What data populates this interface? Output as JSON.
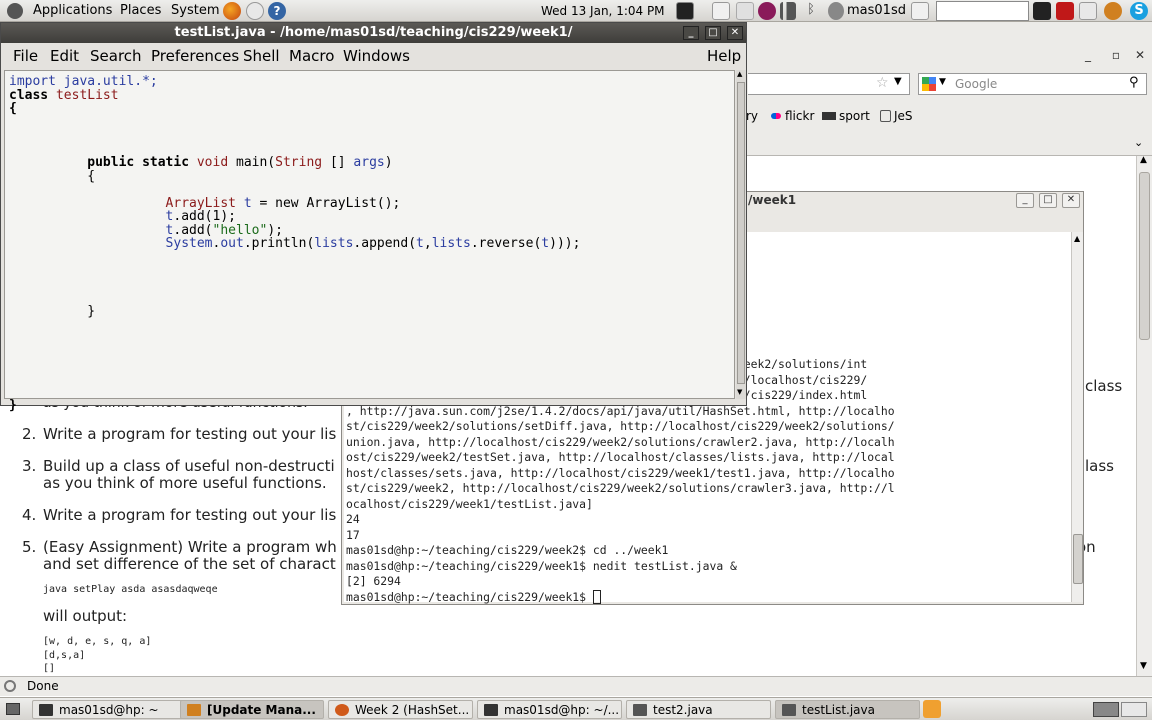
{
  "top_panel": {
    "menus": [
      "Applications",
      "Places",
      "System"
    ],
    "clock": "Wed 13 Jan,  1:04 PM",
    "user": "mas01sd"
  },
  "nedit": {
    "title": "testList.java - /home/mas01sd/teaching/cis229/week1/",
    "menus": [
      "File",
      "Edit",
      "Search",
      "Preferences",
      "Shell",
      "Macro",
      "Windows"
    ],
    "help": "Help",
    "code": {
      "import_kw": "import",
      "import_pkg": "java.util.*;",
      "class_kw": "class",
      "class_name": "testList",
      "open_brace": "{",
      "main_sig_a": "public static",
      "main_sig_void": "void",
      "main_sig_b": "main(",
      "main_sig_string": "String",
      "main_sig_c": "[] ",
      "main_sig_args": "args",
      "main_sig_d": ")",
      "main_open": "{",
      "l1_type": "ArrayList",
      "l1_var": "t",
      "l1_rest": " = new ArrayList();",
      "l2_var": "t",
      "l2_rest": ".add(1);",
      "l3_var": "t",
      "l3_mid": ".add(",
      "l3_str": "\"hello\"",
      "l3_end": ");",
      "l4_sys": "System",
      "l4_dot": ".",
      "l4_out": "out",
      "l4_a": ".println(",
      "l4_lists1": "lists",
      "l4_b": ".append(",
      "l4_t1": "t",
      "l4_c": ",",
      "l4_lists2": "lists",
      "l4_d": ".reverse(",
      "l4_t2": "t",
      "l4_e": ")));",
      "main_close": "}",
      "class_close": "}"
    }
  },
  "terminal": {
    "title": "/week1",
    "lines": [
      "                                                    s229/week2/solutions/int",
      "                                                    http://localhost/cis229/",
      "                                                    alhost/cis229/index.html",
      ", http://java.sun.com/j2se/1.4.2/docs/api/java/util/HashSet.html, http://localho",
      "st/cis229/week2/solutions/setDiff.java, http://localhost/cis229/week2/solutions/",
      "union.java, http://localhost/cis229/week2/solutions/crawler2.java, http://localh",
      "ost/cis229/week2/testSet.java, http://localhost/classes/lists.java, http://local",
      "host/classes/sets.java, http://localhost/cis229/week1/test1.java, http://localho",
      "st/cis229/week2, http://localhost/cis229/week2/solutions/crawler3.java, http://l",
      "ocalhost/cis229/week1/testList.java]",
      "24",
      "17",
      "mas01sd@hp:~/teaching/cis229/week2$ cd ../week1",
      "mas01sd@hp:~/teaching/cis229/week1$ nedit testList.java &",
      "[2] 6294"
    ],
    "prompt": "mas01sd@hp:~/teaching/cis229/week1$ "
  },
  "firefox": {
    "search_placeholder": "Google",
    "bookmarks": [
      "ry",
      "flickr",
      "sport",
      "JeS"
    ],
    "status": "Done",
    "page": {
      "item1_tail": "as you think of more useful functions.",
      "item1_right": "class",
      "item2_num": "2.",
      "item2": "Write a program for testing out your lis",
      "item3_num": "3.",
      "item3_a": "Build up a class of useful non-destructi",
      "item3_b": "as you think of more useful functions.",
      "item3_right": "lass",
      "item4_num": "4.",
      "item4": "Write a program for testing out your lis",
      "item5_num": "5.",
      "item5_a": "(Easy Assignment) Write a program wh",
      "item5_b": "and set difference of the set of charact",
      "item5_right": "on",
      "cmd": "java setPlay asda asasdaqweqe",
      "will_output": "will output:",
      "out1": "[w, d, e, s, q, a]",
      "out2": "[d,s,a]",
      "out3": "[]"
    }
  },
  "taskbar": {
    "tasks": [
      "mas01sd@hp: ~",
      "[Update Mana...",
      "Week 2 (HashSet...",
      "mas01sd@hp: ~/...",
      "test2.java",
      "testList.java"
    ]
  }
}
